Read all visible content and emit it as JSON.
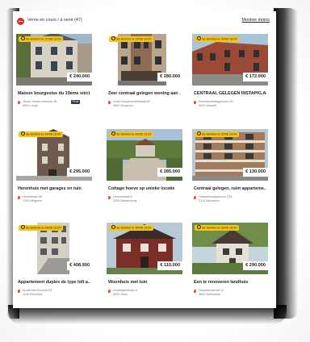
{
  "header": {
    "title": "Vente en cours / à venir (47)",
    "show_less": "Montrer moins"
  },
  "colors": {
    "badge": "#f5c518",
    "status": "#d0312d",
    "pin": "#e74c3c"
  },
  "listings": [
    {
      "badge": "Se termine le 21/06 13:00",
      "price": "€ 240.000",
      "title": "Maison bourgeoise du 19ème siècl...",
      "address": "Simon Sainte-Maxime 38",
      "city": "4000 Liège",
      "tag": "Proxi"
    },
    {
      "badge": "Se termine le 22/06 13:00",
      "price": "€ 280.000",
      "title": "Zeer centraal gelegen woning aan ...",
      "address": "Grote Koophandelstraat 55",
      "city": "3800 Borgloon",
      "tag": ""
    },
    {
      "badge": "Se termine le 23/06 13:00",
      "price": "€ 172.000",
      "title": "CENTRAAL GELEGEN INSTAPKLAR...",
      "address": "Schreeuwhofsgewoon 55",
      "city": "3010 Hasselt",
      "tag": ""
    },
    {
      "badge": "Se termine le 24/06 13:00",
      "price": "€ 295.000",
      "title": "Herenhuis met garages en tuin",
      "address": "Herlestraat 46",
      "city": "1760 Aflighem",
      "tag": ""
    },
    {
      "badge": "Se termine le 25/06 13:00",
      "price": "€ 285.000",
      "title": "Cottage hoeve op unieke locatie",
      "address": "Hoevestraat 8",
      "city": "2250 Retsebeerg",
      "tag": ""
    },
    {
      "badge": "Se termine le 25/06 13:00",
      "price": "€ 130.000",
      "title": "Centraal gelegen, ruim apparteme...",
      "address": "Leidsestraatgebouw 234",
      "city": "2110 Mencelen",
      "tag": ""
    },
    {
      "badge": "Se termine le 26/06 13:00",
      "price": "€ 408.900",
      "title": "Appartement duplex de type loft a...",
      "address": "Boulevard Brouvel 83",
      "city": "1190 Bruxelles",
      "tag": ""
    },
    {
      "badge": "Se termine le 26/06 13:00",
      "price": "€ 110.000",
      "title": "Woonhuis met tuin",
      "address": "Oostkapelstraat 8",
      "city": "9000 Gent",
      "tag": ""
    },
    {
      "badge": "Se termine le 26/06 13:00",
      "price": "€ 290.000",
      "title": "Een te renoveren landhuis",
      "address": "Fysiostenstraat 10",
      "city": "3600 Nettebeak",
      "tag": ""
    }
  ]
}
